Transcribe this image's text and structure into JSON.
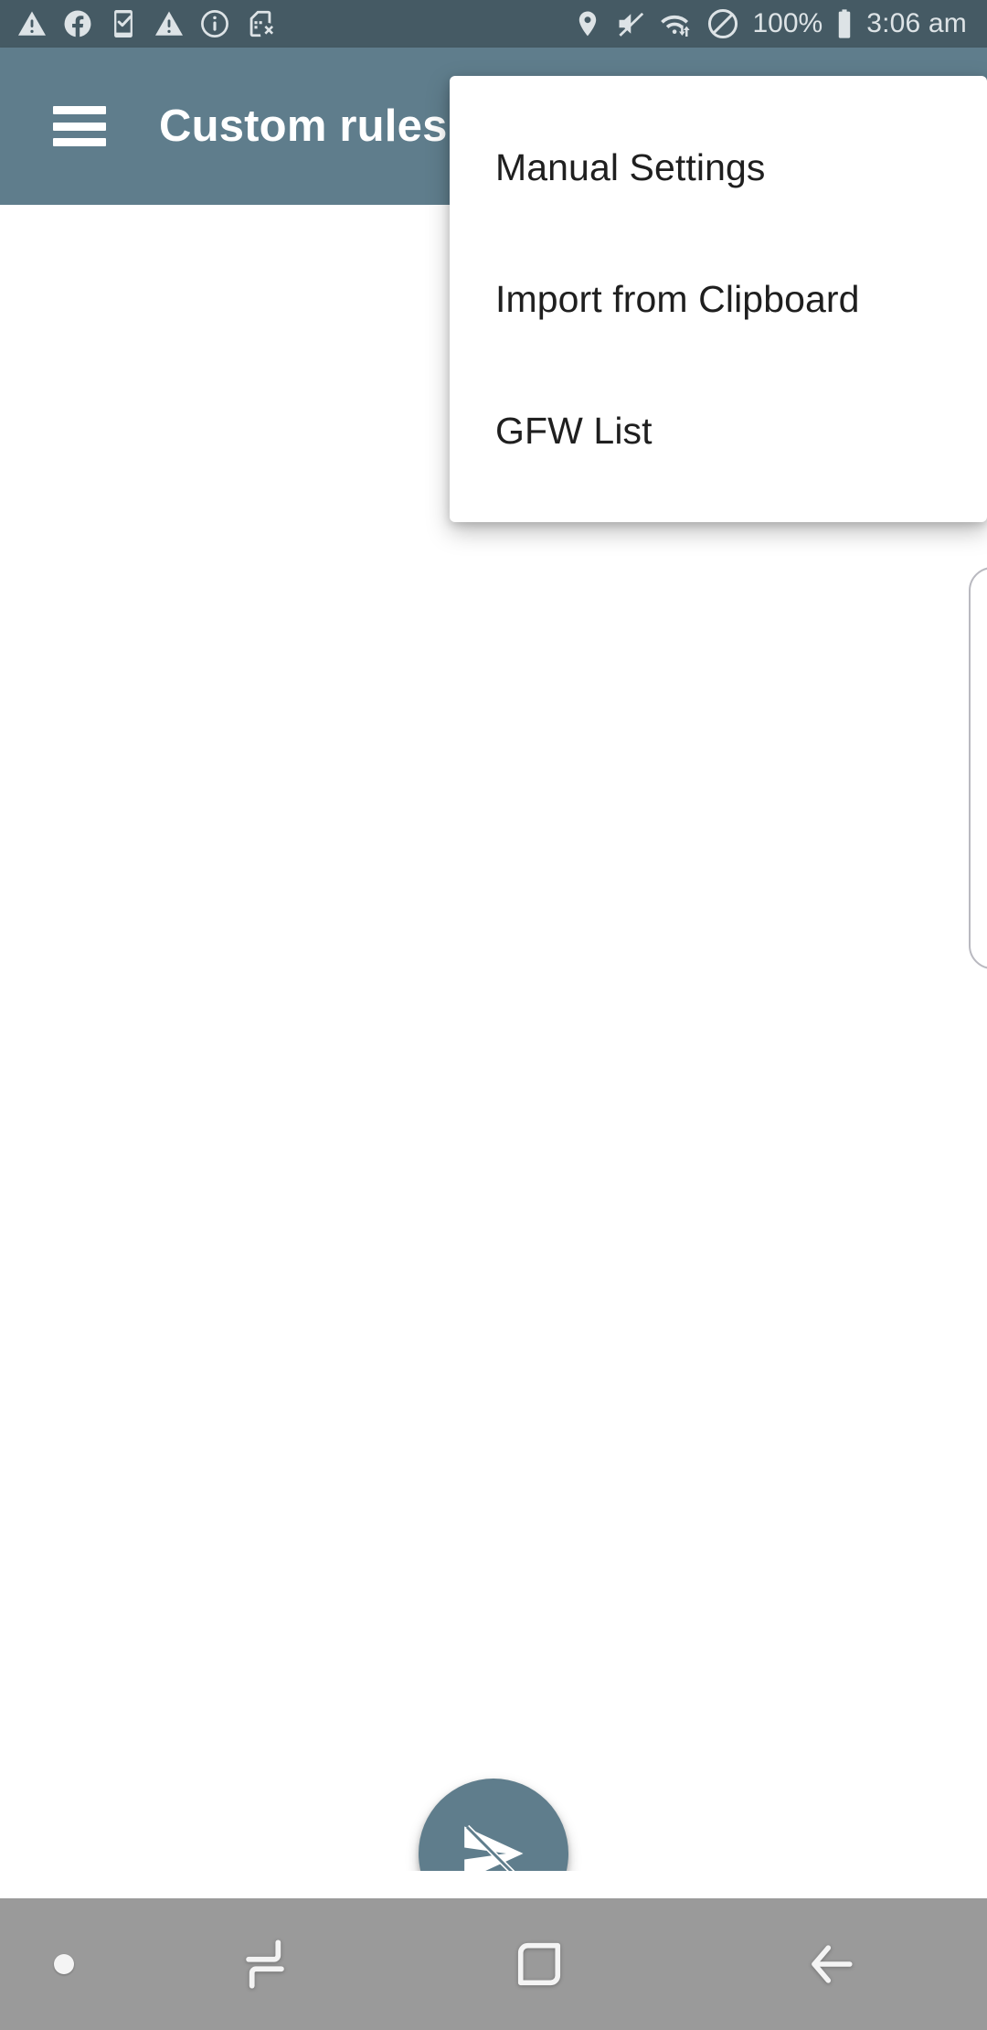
{
  "status_bar": {
    "background": "#455a64",
    "foreground": "#dde3e6",
    "left_icons": [
      {
        "name": "warning-triangle-icon",
        "label": "Warning"
      },
      {
        "name": "facebook-icon",
        "label": "Facebook"
      },
      {
        "name": "phone-check-icon",
        "label": "Device check"
      },
      {
        "name": "warning-triangle-icon-2",
        "label": "Warning"
      },
      {
        "name": "info-circle-icon",
        "label": "Information"
      },
      {
        "name": "sim-card-off-icon",
        "label": "No SIM card"
      }
    ],
    "right_icons": [
      {
        "name": "location-pin-icon",
        "label": "Location"
      },
      {
        "name": "volume-mute-icon",
        "label": "Muted"
      },
      {
        "name": "wifi-transfer-icon",
        "label": "Wi-Fi data transfer"
      },
      {
        "name": "do-not-disturb-icon",
        "label": "Do not disturb"
      }
    ],
    "battery_percent": "100%",
    "battery_icon": "battery-full-icon",
    "clock": "3:06 am"
  },
  "app_bar": {
    "background": "#5f7d8c",
    "menu_icon": "hamburger-menu-icon",
    "title": "Custom rules"
  },
  "popup_menu": {
    "background": "#ffffff",
    "items": [
      {
        "label": "Manual Settings"
      },
      {
        "label": "Import from Clipboard"
      },
      {
        "label": "GFW List"
      }
    ]
  },
  "main": {
    "background": "#ffffff",
    "edge_card": {
      "name": "offscreen-card-edge"
    },
    "fab": {
      "icon": "send-disabled-icon",
      "background": "#5f7d8c",
      "label": "Disconnected"
    }
  },
  "nav_bar": {
    "background": "#9a9a9a",
    "items": [
      {
        "name": "nav-dot-indicator",
        "icon": "dot-icon"
      },
      {
        "name": "nav-switch-button",
        "icon": "swap-icon"
      },
      {
        "name": "nav-home-button",
        "icon": "square-home-icon"
      },
      {
        "name": "nav-back-button",
        "icon": "back-arrow-icon"
      }
    ]
  }
}
